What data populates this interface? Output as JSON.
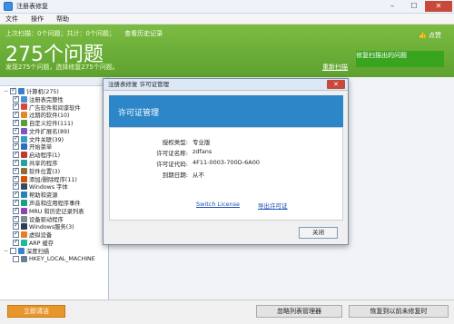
{
  "window": {
    "title": "注册表修复",
    "min": "–",
    "max": "☐",
    "close": "✕"
  },
  "menu": [
    "文件",
    "操作",
    "帮助"
  ],
  "banner": {
    "scan_summary": "上次扫描：0个问题；共计：0个问题；",
    "history_link": "查看历史记录",
    "issue_count": "275个问题",
    "subtitle": "发现275个问题，选择修复275个问题。",
    "like": "点赞",
    "rescan": "重新扫描",
    "fix_button": "修复扫描出的问题"
  },
  "tree_header": "",
  "tree": [
    {
      "label": "计算机(275)",
      "indent": 0,
      "expander": "−",
      "checked": true,
      "icon": "#3a7fd0"
    },
    {
      "label": "注册表完整性",
      "indent": 1,
      "checked": true,
      "icon": "#4a90d9"
    },
    {
      "label": "广告软件和间谍软件",
      "indent": 1,
      "checked": true,
      "icon": "#d9463a"
    },
    {
      "label": "过期的软件(10)",
      "indent": 1,
      "checked": true,
      "icon": "#e08a2a"
    },
    {
      "label": "自定义控件(111)",
      "indent": 1,
      "checked": true,
      "icon": "#5a9e3a"
    },
    {
      "label": "文件扩展名(89)",
      "indent": 1,
      "checked": true,
      "icon": "#7a5ac0"
    },
    {
      "label": "文件关联(39)",
      "indent": 1,
      "checked": true,
      "icon": "#3a9ec0"
    },
    {
      "label": "开始菜单",
      "indent": 1,
      "checked": true,
      "icon": "#2a6fb8"
    },
    {
      "label": "启动程序(1)",
      "indent": 1,
      "checked": true,
      "icon": "#c0392b"
    },
    {
      "label": "共享的程序",
      "indent": 1,
      "checked": true,
      "icon": "#27a0a0"
    },
    {
      "label": "软件位置(3)",
      "indent": 1,
      "checked": true,
      "icon": "#8e6e3a"
    },
    {
      "label": "添加/删除程序(11)",
      "indent": 1,
      "checked": true,
      "icon": "#d35400"
    },
    {
      "label": "Windows 字体",
      "indent": 1,
      "checked": true,
      "icon": "#34495e"
    },
    {
      "label": "帮助和资源",
      "indent": 1,
      "checked": true,
      "icon": "#2980b9"
    },
    {
      "label": "声音和应用程序事件",
      "indent": 1,
      "checked": true,
      "icon": "#16a085"
    },
    {
      "label": "MRU 和历史记录列表",
      "indent": 1,
      "checked": true,
      "icon": "#8e44ad"
    },
    {
      "label": "设备驱动程序",
      "indent": 1,
      "checked": true,
      "icon": "#7f8c8d"
    },
    {
      "label": "Windows服务(3)",
      "indent": 1,
      "checked": true,
      "icon": "#2c3e50"
    },
    {
      "label": "虚拟设备",
      "indent": 1,
      "checked": true,
      "icon": "#e67e22"
    },
    {
      "label": "ARP 缓存",
      "indent": 1,
      "checked": true,
      "icon": "#1abc9c"
    },
    {
      "label": "深度扫描",
      "indent": 0,
      "expander": "−",
      "checked": false,
      "icon": "#3a7fd0"
    },
    {
      "label": "HKEY_LOCAL_MACHINE",
      "indent": 1,
      "checked": false,
      "icon": "#6a7f96"
    }
  ],
  "bottom": {
    "clean_now": "立即清洁",
    "ignore_list": "忽略列表管理器",
    "restore": "恢复到以前未修复时"
  },
  "dialog": {
    "title": "注册表修复 许可证管理",
    "heading": "许可证管理",
    "close_label": "关闭",
    "fields": [
      {
        "key": "授权类型:",
        "value": "专业版"
      },
      {
        "key": "许可证名称:",
        "value": "zdfans"
      },
      {
        "key": "许可证代码:",
        "value": "4F11-0003-700D-6A00"
      },
      {
        "key": "到期日期:",
        "value": "从不"
      }
    ],
    "switch_license": "Switch License",
    "export_license": "导出许可证"
  },
  "colors": {
    "banner_green": "#6fb03a",
    "fix_green": "#39a51f",
    "dialog_blue": "#2c86c8",
    "clean_orange": "#e6962a"
  }
}
